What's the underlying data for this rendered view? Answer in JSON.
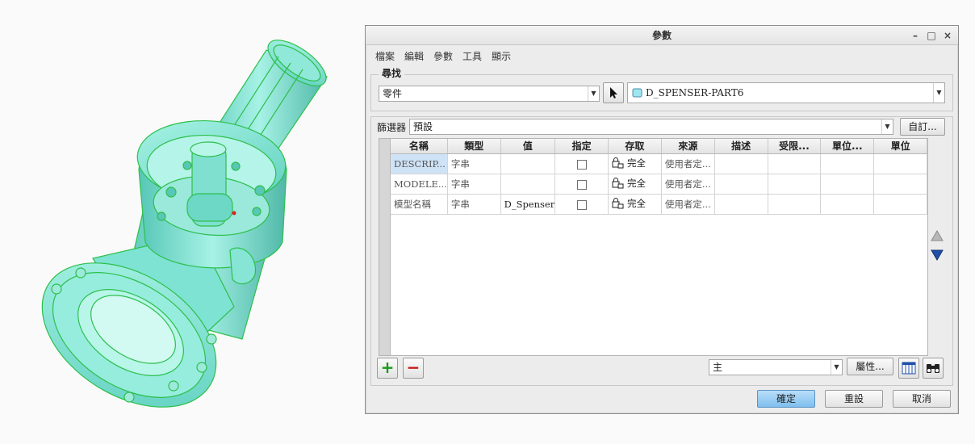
{
  "dialog": {
    "title": "參數",
    "window_controls": {
      "minimize": "–",
      "maximize": "□",
      "close": "×"
    },
    "menu": [
      "檔案",
      "編輯",
      "參數",
      "工具",
      "顯示"
    ]
  },
  "find": {
    "legend": "尋找",
    "type_value": "零件",
    "object_value": "D_SPENSER-PART6"
  },
  "filter": {
    "label": "篩選器",
    "value": "預設",
    "customize_button": "自訂..."
  },
  "table": {
    "headers": [
      "名稱",
      "類型",
      "值",
      "指定",
      "存取",
      "來源",
      "描述",
      "受限...",
      "單位...",
      "單位"
    ],
    "rows": [
      {
        "name": "DESCRIP...",
        "type": "字串",
        "value": "",
        "access": "完全",
        "source": "使用者定..."
      },
      {
        "name": "MODELE...",
        "type": "字串",
        "value": "",
        "access": "完全",
        "source": "使用者定..."
      },
      {
        "name": "模型名稱",
        "type": "字串",
        "value": "D_Spenser",
        "access": "完全",
        "source": "使用者定..."
      }
    ]
  },
  "bottom": {
    "add_label": "+",
    "remove_label": "−",
    "main_value": "主",
    "properties_button": "屬性..."
  },
  "actions": {
    "ok": "確定",
    "reset": "重設",
    "cancel": "取消"
  },
  "colors": {
    "model_fill": "#6fe0cc",
    "model_edges": "#2dbf4c",
    "selected_cell": "#cfe3f7",
    "ok_button": "#8cc8f2",
    "add_icon": "#1a9a1a",
    "remove_icon": "#c81818"
  },
  "icons": {
    "select": "arrow-cursor-icon",
    "part": "part-icon",
    "access": "lock-icon",
    "table_columns": "columns-icon",
    "find": "binoculars-icon",
    "scroll_up": "triangle-up-icon",
    "scroll_down": "triangle-down-icon"
  }
}
